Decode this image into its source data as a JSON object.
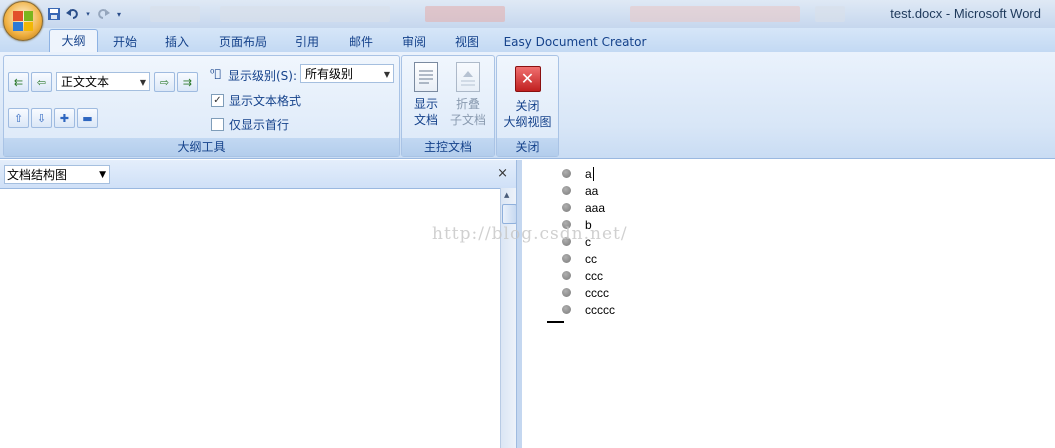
{
  "window": {
    "title": "test.docx - Microsoft Word"
  },
  "quick_access": {
    "icons": [
      "save-icon",
      "undo-icon",
      "redo-icon",
      "customize-icon"
    ]
  },
  "tabs": [
    {
      "label": "大纲",
      "active": true
    },
    {
      "label": "开始"
    },
    {
      "label": "插入"
    },
    {
      "label": "页面布局"
    },
    {
      "label": "引用"
    },
    {
      "label": "邮件"
    },
    {
      "label": "审阅"
    },
    {
      "label": "视图"
    },
    {
      "label": "Easy Document Creator"
    }
  ],
  "outline_tools": {
    "group_label": "大纲工具",
    "level_select": "正文文本",
    "show_level_label": "显示级别(S):",
    "show_level_value": "所有级别",
    "show_text_format_label": "显示文本格式",
    "show_text_format_checked": true,
    "first_line_only_label": "仅显示首行",
    "first_line_only_checked": false
  },
  "master_doc": {
    "group_label": "主控文档",
    "show_doc_label": "显示\n文档",
    "collapse_sub_label": "折叠\n子文档"
  },
  "close_group": {
    "group_label": "关闭",
    "close_outline_label": "关闭\n大纲视图"
  },
  "nav_pane": {
    "mode": "文档结构图",
    "close_glyph": "×"
  },
  "document": {
    "watermark": "http://blog.csdn.net/",
    "outline_items": [
      "a",
      "aa",
      "aaa",
      "b",
      "c",
      "cc",
      "ccc",
      "cccc",
      "ccccc"
    ]
  },
  "colors": {
    "ribbon_text": "#15428b",
    "tab_bar": "#c3d9f3"
  }
}
